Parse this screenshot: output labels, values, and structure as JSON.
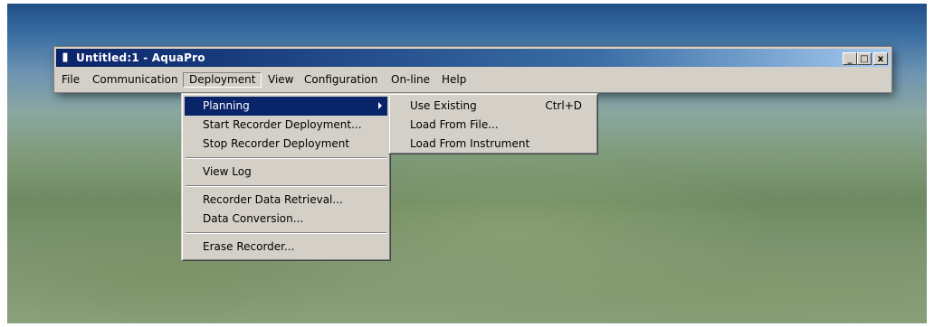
{
  "window": {
    "title": "Untitled:1 - AquaPro"
  },
  "title_controls": {
    "minimize": "_",
    "maximize": "□",
    "close": "x"
  },
  "menu_bar": {
    "items": [
      "File",
      "Communication",
      "Deployment",
      "View",
      "Configuration",
      "On-line",
      "Help"
    ],
    "active": "Deployment"
  },
  "deployment_menu": {
    "items": [
      {
        "label": "Planning",
        "submenu": true,
        "highlighted": true
      },
      {
        "label": "Start Recorder Deployment..."
      },
      {
        "label": "Stop Recorder Deployment"
      },
      {
        "label": "View Log"
      },
      {
        "label": "Recorder Data Retrieval..."
      },
      {
        "label": "Data Conversion..."
      },
      {
        "label": "Erase Recorder..."
      }
    ]
  },
  "planning_submenu": {
    "items": [
      {
        "label": "Use Existing",
        "shortcut": "Ctrl+D"
      },
      {
        "label": "Load From File..."
      },
      {
        "label": "Load From Instrument"
      }
    ]
  },
  "colors": {
    "title_bar_start": "#0a246a",
    "title_bar_end": "#a6caf0",
    "menu_face": "#d4d0c8",
    "highlight": "#0a246a"
  }
}
